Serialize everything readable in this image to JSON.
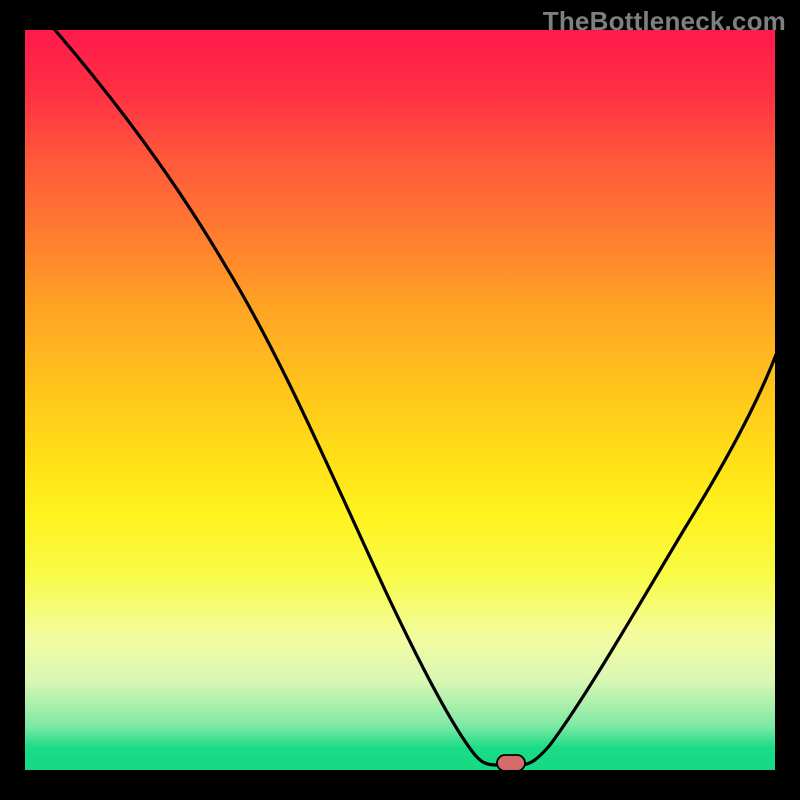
{
  "watermark": "TheBottleneck.com",
  "chart_data": {
    "type": "line",
    "title": "",
    "xlabel": "",
    "ylabel": "",
    "xlim": [
      0,
      100
    ],
    "ylim": [
      0,
      100
    ],
    "grid": false,
    "legend": false,
    "series": [
      {
        "name": "bottleneck-curve",
        "x": [
          0,
          10,
          20,
          30,
          40,
          50,
          55,
          60,
          63,
          65,
          70,
          80,
          90,
          100
        ],
        "y": [
          100,
          86,
          72,
          58,
          40,
          20,
          10,
          4,
          0.5,
          0.5,
          8,
          25,
          43,
          60
        ]
      }
    ],
    "annotations": [
      {
        "name": "optimal-marker",
        "x": 64,
        "y": 0.5
      }
    ],
    "background_gradient": {
      "top": "#ff1a4b",
      "mid": "#ffe016",
      "bottom": "#16d983"
    }
  }
}
